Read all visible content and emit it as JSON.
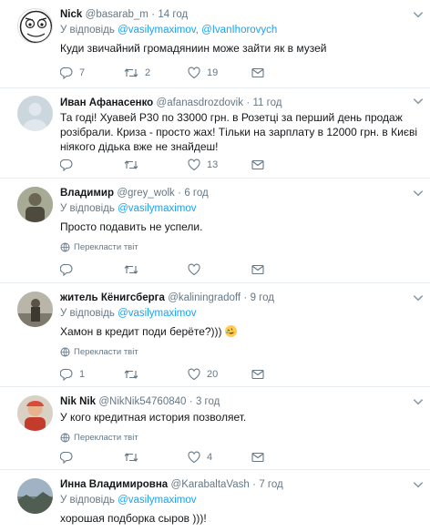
{
  "tweets": [
    {
      "name": "Nick",
      "handle": "@basarab_m",
      "time": "14 год",
      "reply_prefix": "У відповідь",
      "reply_to": "@vasilymaximov",
      "reply_and": ", ",
      "reply_to2": "@IvanIhorovych",
      "text": "Куди звичайний громадяниин може зайти як в музей",
      "replies": "7",
      "retweets": "2",
      "likes": "19"
    },
    {
      "name": "Иван Афанасенко",
      "handle": "@afanasdrozdovik",
      "time": "11 год",
      "text": "Та годі! Хуавей Р30 по 33000 грн. в Розетці за перший день продаж розібрали. Криза - просто жах! Тільки на зарплату в 12000 грн. в Києві ніякого дідька вже не знайдеш!",
      "replies": "",
      "retweets": "",
      "likes": "13"
    },
    {
      "name": "Владимир",
      "handle": "@grey_wolk",
      "time": "6 год",
      "reply_prefix": "У відповідь",
      "reply_to": "@vasilymaximov",
      "text": "Просто подавить не успели.",
      "translate": "Перекласти твіт",
      "replies": "",
      "retweets": "",
      "likes": ""
    },
    {
      "name": "житель Кёнигсберга",
      "handle": "@kaliningradoff",
      "time": "9 год",
      "reply_prefix": "У відповідь",
      "reply_to": "@vasilymaximov",
      "text": "Хамон в кредит поди берёте?)))",
      "emoji": "rolling-laughing-emoji",
      "translate": "Перекласти твіт",
      "replies": "1",
      "retweets": "",
      "likes": "20"
    },
    {
      "name": "Nik Nik",
      "handle": "@NikNik54760840",
      "time": "3 год",
      "text": "У кого кредитная история позволяет.",
      "translate": "Перекласти твіт",
      "replies": "",
      "retweets": "",
      "likes": "4"
    },
    {
      "name": "Инна Владимировна",
      "handle": "@KarabaltaVash",
      "time": "7 год",
      "reply_prefix": "У відповідь",
      "reply_to": "@vasilymaximov",
      "text": "хорошая подборка сыров )))!",
      "replies": "",
      "retweets": "",
      "likes": ""
    }
  ],
  "separator": "·",
  "colors": {
    "link": "#1da1f2",
    "muted": "#657786",
    "divider": "#e6ecf0"
  }
}
